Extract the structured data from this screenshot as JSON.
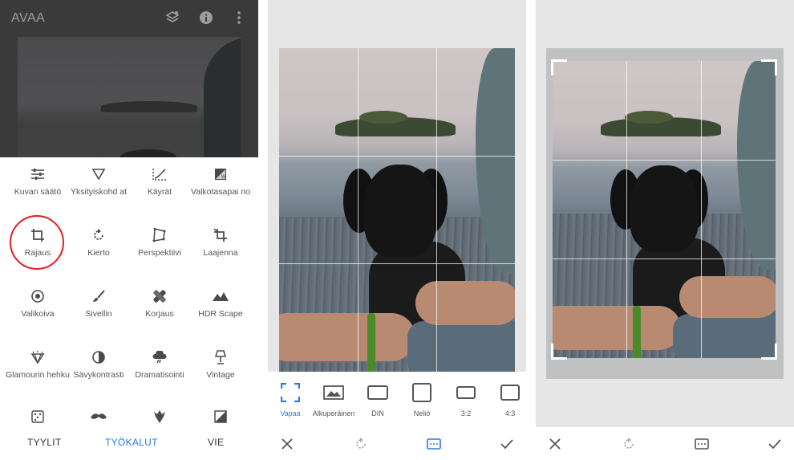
{
  "panel1": {
    "title": "AVAA",
    "icons": [
      "layers-icon",
      "info-icon",
      "more-vert-icon"
    ],
    "tools": [
      {
        "label": "Kuvan säätö",
        "icon": "tune-icon"
      },
      {
        "label": "Yksityiskohd at",
        "icon": "details-triangle-icon"
      },
      {
        "label": "Käyrät",
        "icon": "curves-icon"
      },
      {
        "label": "Valkotasapai no",
        "icon": "white-balance-icon"
      },
      {
        "label": "Rajaus",
        "icon": "crop-icon"
      },
      {
        "label": "Kierto",
        "icon": "rotate-icon"
      },
      {
        "label": "Perspektiivi",
        "icon": "perspective-icon"
      },
      {
        "label": "Laajenna",
        "icon": "expand-icon"
      },
      {
        "label": "Valikoiva",
        "icon": "selective-icon"
      },
      {
        "label": "Sivellin",
        "icon": "brush-icon"
      },
      {
        "label": "Korjaus",
        "icon": "healing-icon"
      },
      {
        "label": "HDR Scape",
        "icon": "hdr-mountains-icon"
      },
      {
        "label": "Glamourin hehku",
        "icon": "glamour-glow-icon"
      },
      {
        "label": "Sävykontrasti",
        "icon": "tonal-contrast-icon"
      },
      {
        "label": "Dramatisointi",
        "icon": "drama-icon"
      },
      {
        "label": "Vintage",
        "icon": "vintage-lamp-icon"
      },
      {
        "label": "",
        "icon": "grainy-film-icon"
      },
      {
        "label": "",
        "icon": "mustache-icon"
      },
      {
        "label": "",
        "icon": "grunge-icon"
      },
      {
        "label": "",
        "icon": "black-white-icon"
      }
    ],
    "tabs": {
      "styles": "TYYLIT",
      "tools": "TYÖKALUT",
      "export": "VIE"
    },
    "highlight_color": "#e01f1f",
    "accent_color": "#2a7ae2"
  },
  "panel2": {
    "aspect_ratios": [
      {
        "label": "Vapaa",
        "icon": "free-crop-icon",
        "active": true
      },
      {
        "label": "Alkuperäinen",
        "icon": "original-image-icon",
        "active": false
      },
      {
        "label": "DIN",
        "icon": "din-rect-icon",
        "active": false
      },
      {
        "label": "Neliö",
        "icon": "square-icon",
        "active": false
      },
      {
        "label": "3:2",
        "icon": "ratio-3-2-icon",
        "active": false
      },
      {
        "label": "4:3",
        "icon": "ratio-4-3-icon",
        "active": false
      }
    ],
    "actions": [
      "close-icon",
      "rotate-icon",
      "aspect-ratio-icon",
      "check-icon"
    ]
  },
  "panel3": {
    "actions": [
      "close-icon",
      "rotate-icon",
      "aspect-ratio-icon",
      "check-icon"
    ]
  }
}
